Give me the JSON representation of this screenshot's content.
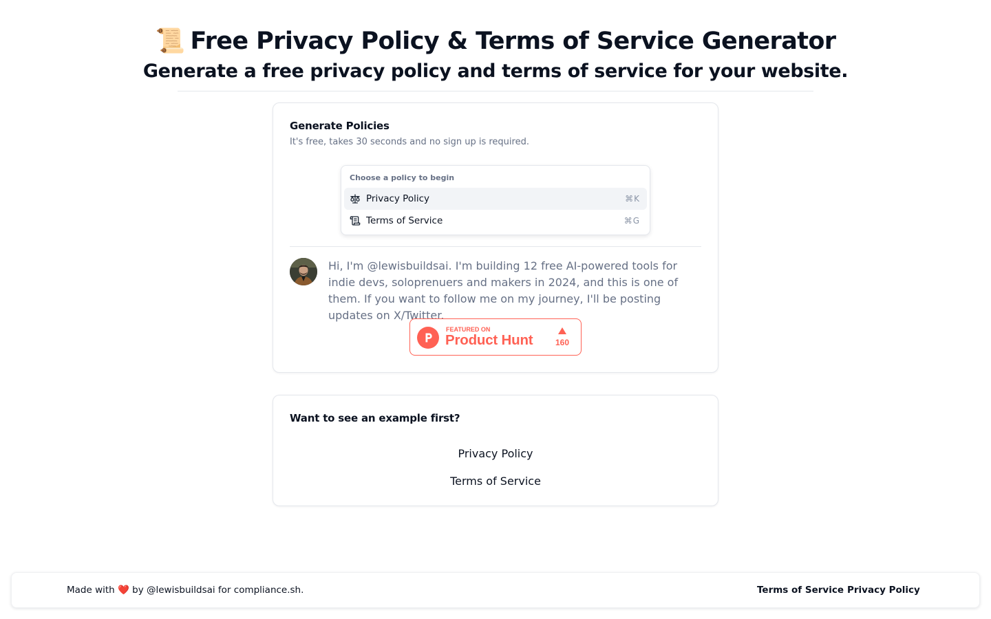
{
  "hero": {
    "emoji": "📜",
    "title": "Free Privacy Policy & Terms of Service Generator",
    "subtitle": "Generate a free privacy policy and terms of service for your website."
  },
  "generate_card": {
    "title": "Generate Policies",
    "subtitle": "It's free, takes 30 seconds and no sign up is required.",
    "command_menu": {
      "heading": "Choose a policy to begin",
      "items": [
        {
          "label": "Privacy Policy",
          "shortcut": "⌘K",
          "icon": "scale-icon",
          "active": true
        },
        {
          "label": "Terms of Service",
          "shortcut": "⌘G",
          "icon": "scroll-icon",
          "active": false
        }
      ]
    },
    "bio": "Hi, I'm @lewisbuildsai. I'm building 12 free AI-powered tools for indie devs, soloprenuers and makers in 2024, and this is one of them. If you want to follow me on my journey, I'll be posting updates on X/Twitter.",
    "product_hunt": {
      "featured": "FEATURED ON",
      "name": "Product Hunt",
      "count": "160",
      "color": "#ff6154"
    }
  },
  "example_card": {
    "title": "Want to see an example first?",
    "links": [
      "Privacy Policy",
      "Terms of Service"
    ]
  },
  "footer": {
    "prefix": "Made with",
    "heart": "❤️",
    "suffix": "by @lewisbuildsai for compliance.sh.",
    "links": [
      "Terms of Service",
      "Privacy Policy"
    ]
  }
}
